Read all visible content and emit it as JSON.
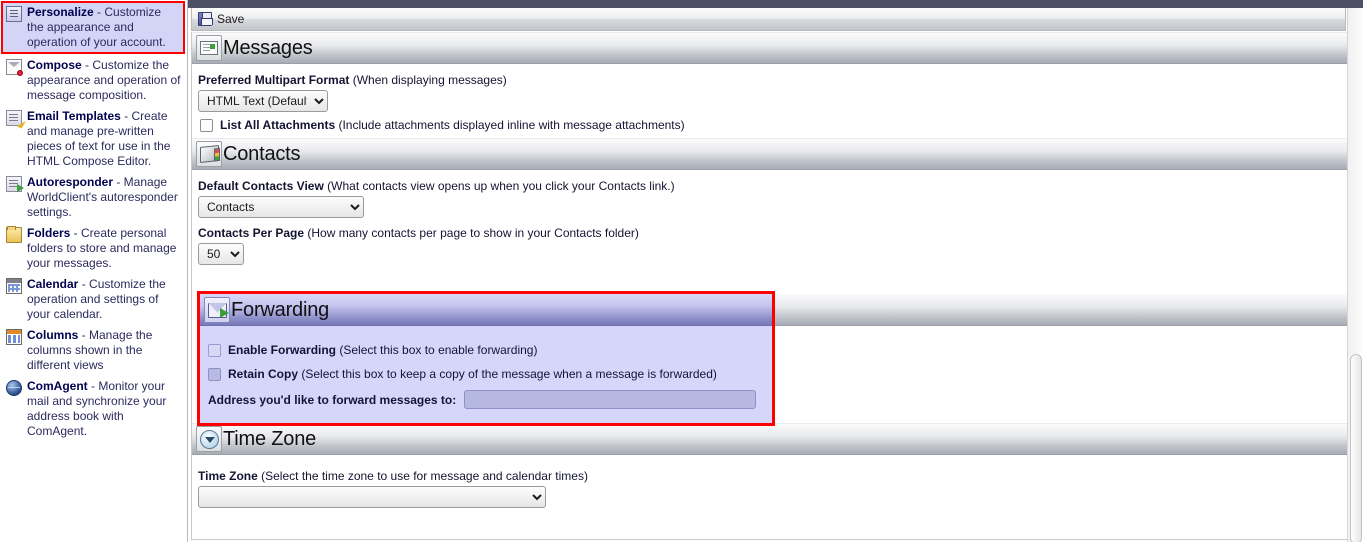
{
  "sidebar": {
    "items": [
      {
        "icon": "personalize-icon",
        "title": "Personalize",
        "desc": " - Customize the appearance and operation of your account.",
        "selected": true
      },
      {
        "icon": "compose-icon",
        "title": "Compose",
        "desc": " - Customize the appearance and operation of message composition.",
        "selected": false
      },
      {
        "icon": "email-templates-icon",
        "title": "Email Templates",
        "desc": " - Create and manage pre-written pieces of text for use in the HTML Compose Editor.",
        "selected": false
      },
      {
        "icon": "autoresponder-icon",
        "title": "Autoresponder",
        "desc": " - Manage WorldClient's autoresponder settings.",
        "selected": false
      },
      {
        "icon": "folders-icon",
        "title": "Folders",
        "desc": " - Create personal folders to store and manage your messages.",
        "selected": false
      },
      {
        "icon": "calendar-icon",
        "title": "Calendar",
        "desc": " - Customize the operation and settings of your calendar.",
        "selected": false
      },
      {
        "icon": "columns-icon",
        "title": "Columns",
        "desc": " - Manage the columns shown in the different views",
        "selected": false
      },
      {
        "icon": "comagent-icon",
        "title": "ComAgent",
        "desc": " - Monitor your mail and synchronize your address book with ComAgent.",
        "selected": false
      }
    ]
  },
  "toolbar": {
    "save_label": "Save",
    "save_icon": "floppy-disk-icon"
  },
  "sections": {
    "messages": {
      "title": "Messages",
      "icon": "messages-icon",
      "multipart_label_bold": "Preferred Multipart Format",
      "multipart_label_rest": " (When displaying messages)",
      "multipart_value": "HTML Text (Default)",
      "multipart_options": [
        "HTML Text (Default)"
      ],
      "list_attachments_bold": "List All Attachments",
      "list_attachments_rest": " (Include attachments displayed inline with message attachments)",
      "list_attachments_checked": false
    },
    "contacts": {
      "title": "Contacts",
      "icon": "contacts-book-icon",
      "default_view_bold": "Default Contacts View",
      "default_view_rest": " (What contacts view opens up when you click your Contacts link.)",
      "default_view_value": "Contacts",
      "default_view_options": [
        "Contacts"
      ],
      "per_page_bold": "Contacts Per Page",
      "per_page_rest": " (How many contacts per page to show in your Contacts folder)",
      "per_page_value": "50",
      "per_page_options": [
        "50"
      ]
    },
    "forwarding": {
      "title": "Forwarding",
      "icon": "forwarding-envelope-icon",
      "highlight_color": "#ff0000",
      "background_color": "#d6d6fb",
      "enable_bold": "Enable Forwarding",
      "enable_rest": " (Select this box to enable forwarding)",
      "enable_checked": false,
      "retain_bold": "Retain Copy",
      "retain_rest": " (Select this box to keep a copy of the message when a message is forwarded)",
      "retain_checked": false,
      "address_label": "Address you'd like to forward messages to:",
      "address_value": "",
      "address_placeholder": ""
    },
    "timezone": {
      "title": "Time Zone",
      "icon": "clock-icon",
      "label_bold": "Time Zone",
      "label_rest": " (Select the time zone to use for message and calendar times)",
      "value": "",
      "options": [
        ""
      ]
    }
  }
}
